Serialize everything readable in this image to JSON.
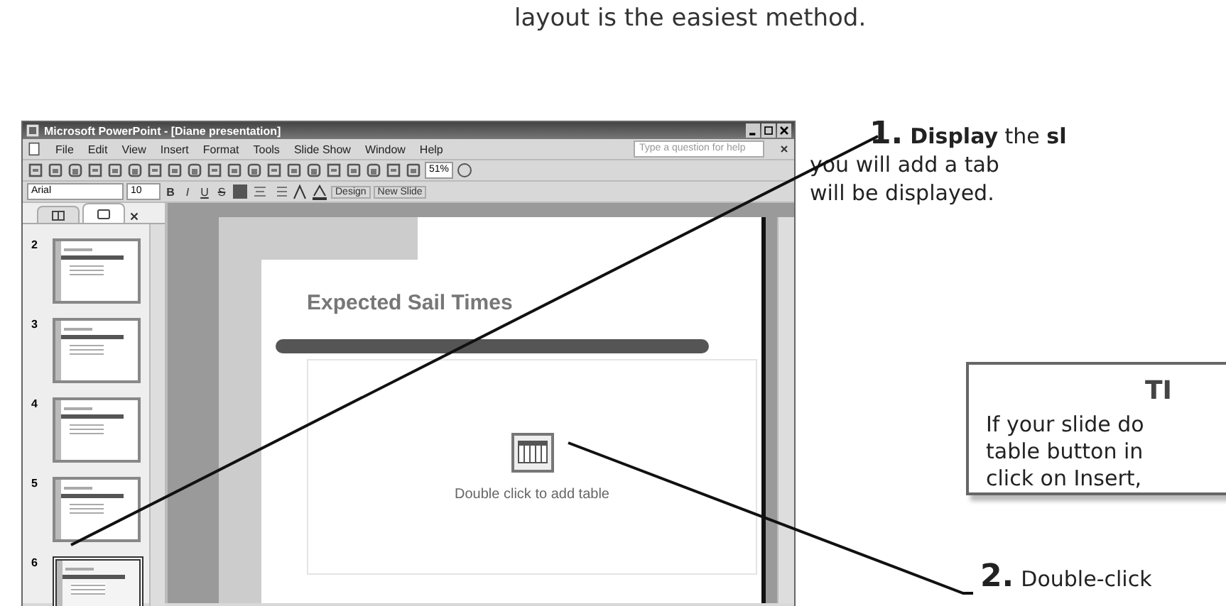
{
  "intro_text": "layout is the easiest method.",
  "window": {
    "title": "Microsoft PowerPoint - [Diane presentation]",
    "menu": [
      "File",
      "Edit",
      "View",
      "Insert",
      "Format",
      "Tools",
      "Slide Show",
      "Window",
      "Help"
    ],
    "help_placeholder": "Type a question for help",
    "zoom": "51%",
    "font": "Arial",
    "font_size": "10",
    "format_buttons": [
      "B",
      "I",
      "U",
      "S"
    ],
    "design_button": "Design",
    "new_slide_button": "New Slide"
  },
  "slide_panel": {
    "tabs": [
      {
        "kind": "outline",
        "selected": false
      },
      {
        "kind": "slides",
        "selected": true
      }
    ],
    "slides": [
      {
        "number": "2",
        "selected": false
      },
      {
        "number": "3",
        "selected": false
      },
      {
        "number": "4",
        "selected": false
      },
      {
        "number": "5",
        "selected": false
      },
      {
        "number": "6",
        "selected": true
      }
    ]
  },
  "slide": {
    "title": "Expected Sail Times",
    "placeholder_text": "Double click to add table"
  },
  "steps": [
    {
      "number": "1.",
      "lines": [
        "**Display** the **sl**",
        "you will add a tab",
        "will be displayed."
      ]
    },
    {
      "number": "2.",
      "lines": [
        "Double-click"
      ]
    }
  ],
  "tip": {
    "title": "TI",
    "lines": [
      "If your slide do",
      "table button in",
      "click on Insert,"
    ]
  }
}
